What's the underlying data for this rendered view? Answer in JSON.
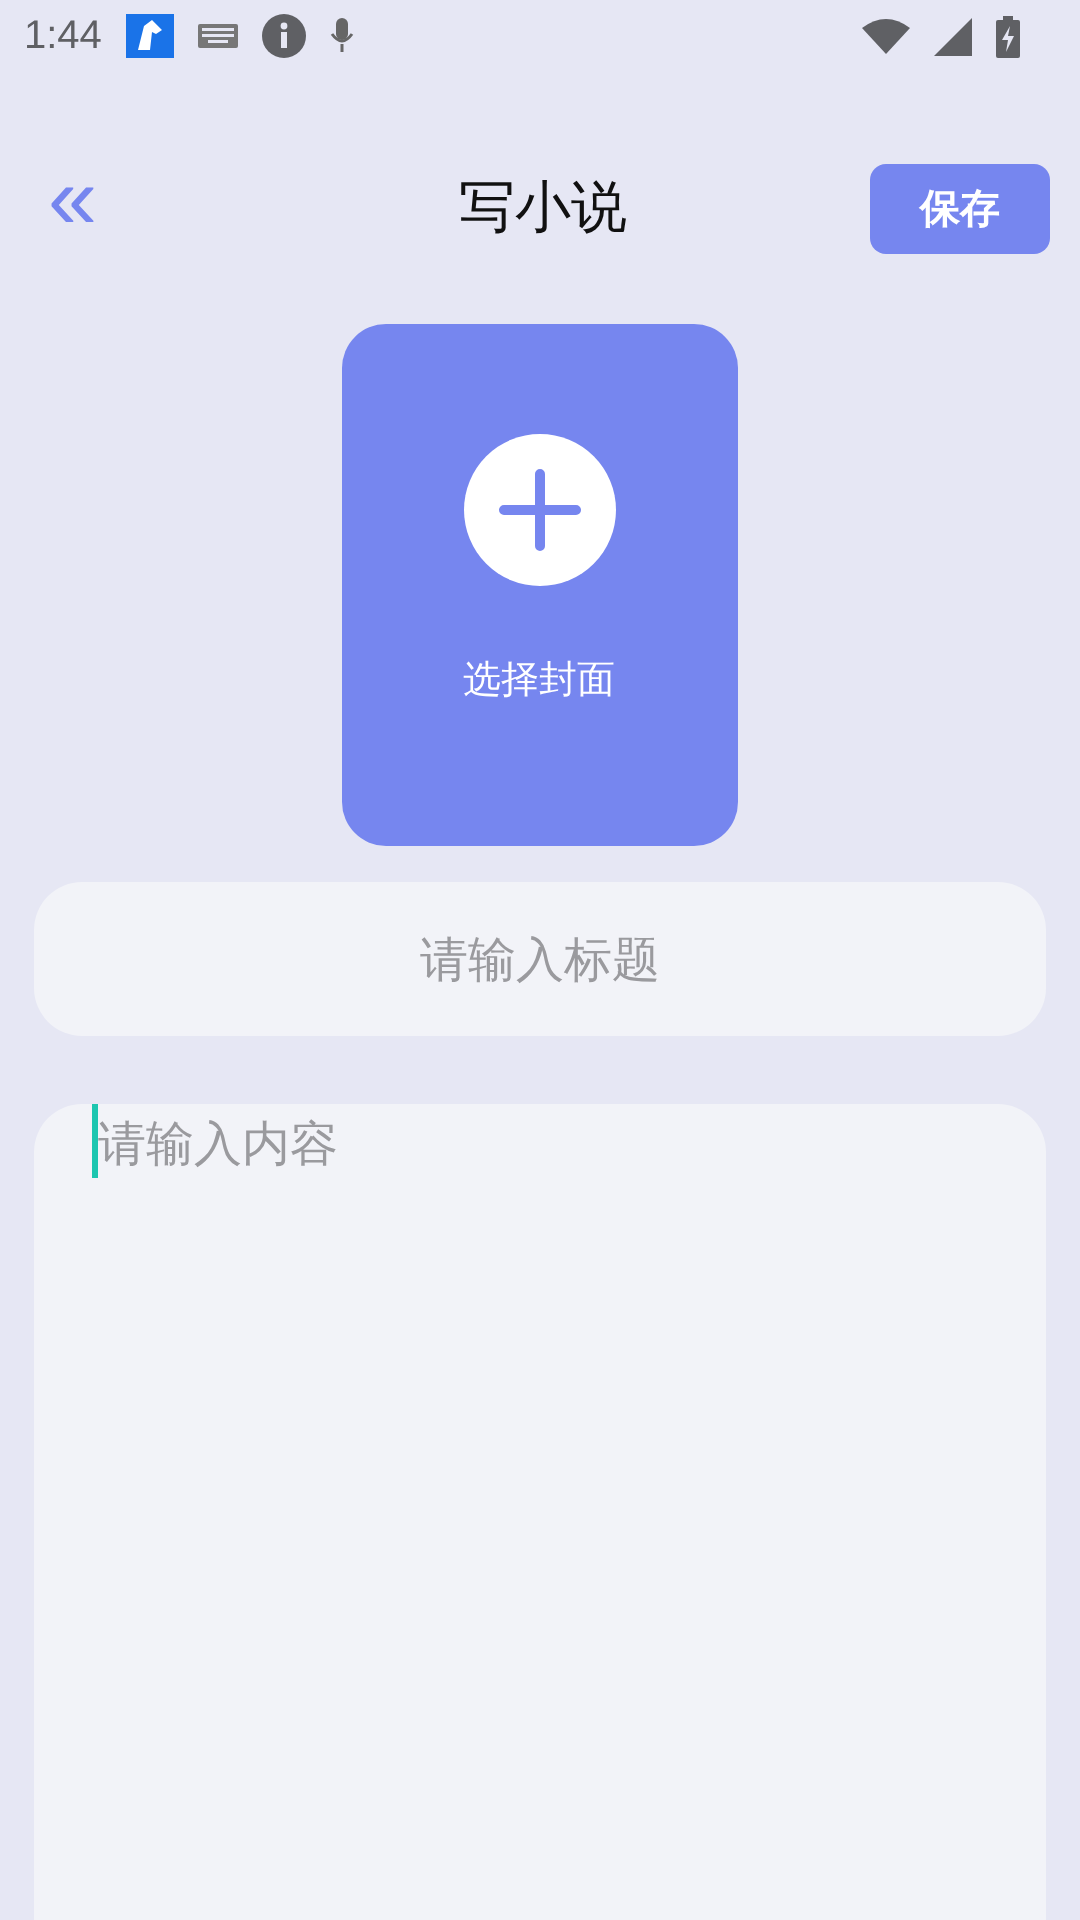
{
  "status_bar": {
    "time": "1:44"
  },
  "header": {
    "back": "«",
    "title": "写小说",
    "save": "保存"
  },
  "cover": {
    "label": "选择封面"
  },
  "title_field": {
    "placeholder": "请输入标题"
  },
  "content_field": {
    "placeholder": "请输入内容",
    "focused": true
  }
}
